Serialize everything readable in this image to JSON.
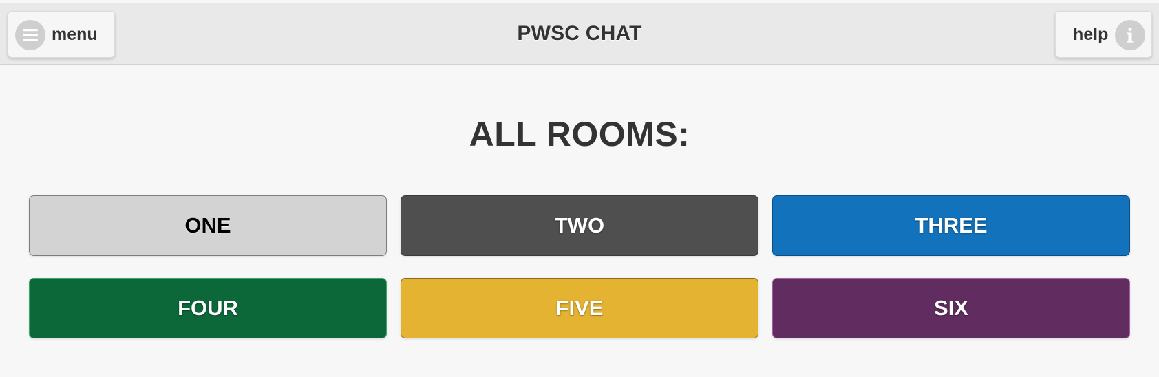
{
  "header": {
    "title": "PWSC CHAT",
    "menu_label": "menu",
    "menu_icon": "hamburger-icon",
    "help_label": "help",
    "help_icon": "info-icon"
  },
  "main": {
    "heading": "ALL ROOMS:",
    "rooms": [
      {
        "label": "ONE",
        "bg": "#d3d3d3",
        "border": "#7d7d7d",
        "text": "#000000"
      },
      {
        "label": "TWO",
        "bg": "#4f4f4f",
        "border": "#3a3a3a",
        "text": "#ffffff"
      },
      {
        "label": "THREE",
        "bg": "#1272bb",
        "border": "#0b4f88",
        "text": "#ffffff"
      },
      {
        "label": "FOUR",
        "bg": "#0c6838",
        "border": "#3fa66b",
        "text": "#ffffff"
      },
      {
        "label": "FIVE",
        "bg": "#e5b332",
        "border": "#8a6c1a",
        "text": "#ffffff"
      },
      {
        "label": "SIX",
        "bg": "#612c5f",
        "border": "#a25f9e",
        "text": "#ffffff"
      }
    ]
  },
  "colors": {
    "header_bg": "#e9e9e9",
    "page_bg": "#f7f7f7",
    "heading_text": "#333333"
  }
}
